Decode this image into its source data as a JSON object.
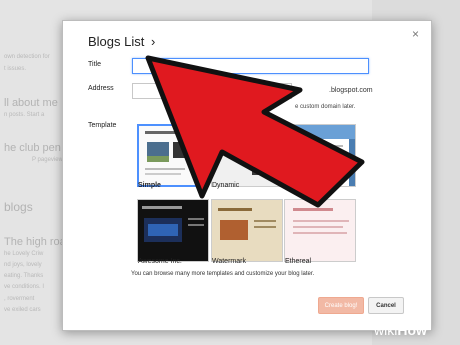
{
  "background": {
    "lines": [
      "own detection for",
      "t issues.",
      "ll about me",
      "n posts. Start a",
      "he club pen",
      "P pageviews",
      "blogs",
      "The high roa",
      "he Lovely Criw",
      "nd joys, lovely",
      "eating. Thanks",
      "ve conditions. I",
      ", roverment",
      "ve exiled cars"
    ]
  },
  "dialog": {
    "title": "Blogs List",
    "title_chevron": "›",
    "close": "×",
    "title_label": "Title",
    "title_value": "",
    "address_label": "Address",
    "address_value": "",
    "address_suffix": ".blogspot.com",
    "address_hint": "e custom domain later.",
    "template_label": "Template",
    "templates": [
      {
        "name": "Simple",
        "selected": true
      },
      {
        "name": "Dynamic",
        "selected": false
      },
      {
        "name": "Picture Window",
        "selected": false
      },
      {
        "name": "Awesome Inc.",
        "selected": false
      },
      {
        "name": "Watermark",
        "selected": false
      },
      {
        "name": "Ethereal",
        "selected": false
      }
    ],
    "browse_text": "You can browse many more templates and customize your blog later.",
    "create_label": "Create blog!",
    "cancel_label": "Cancel"
  },
  "watermark": {
    "wiki": "wiki",
    "how": "How"
  },
  "colors": {
    "accent": "#4d90fe",
    "arrow": "#e0191f",
    "create_button": "#f2b9a5"
  }
}
